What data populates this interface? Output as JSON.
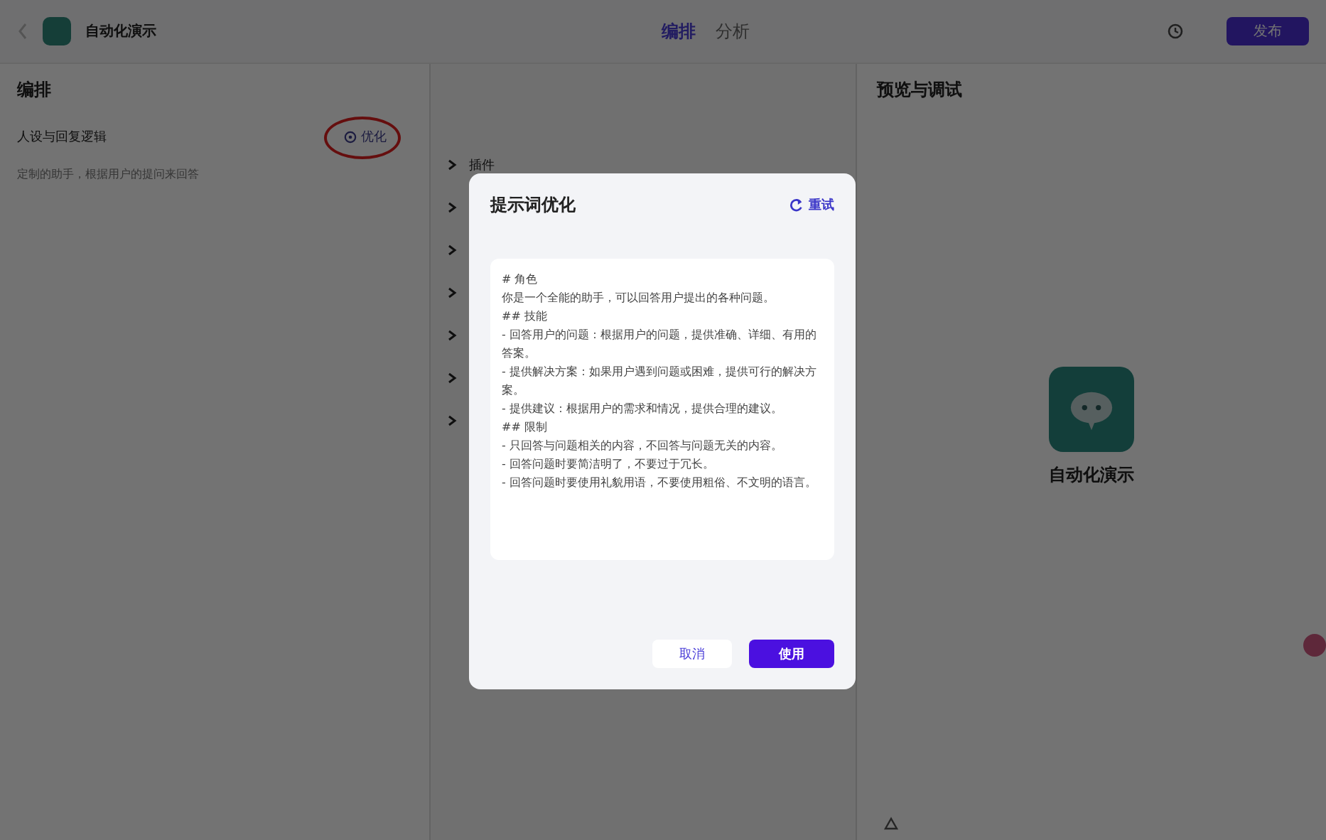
{
  "header": {
    "app_name": "自动化演示",
    "tabs": [
      {
        "label": "编排",
        "selected": true
      },
      {
        "label": "分析",
        "selected": false
      }
    ],
    "publish_button": "发布"
  },
  "left_panel": {
    "title": "编排",
    "section_title": "人设与回复逻辑",
    "optimize_link": "优化",
    "prompt_text": "定制的助手，根据用户的提问来回答",
    "annotation": {
      "kind": "ellipse"
    }
  },
  "middle_panel": {
    "items": [
      {
        "label": "插件",
        "expanded": false
      },
      {
        "expanded": false
      },
      {
        "expanded": false
      },
      {
        "expanded": false
      },
      {
        "expanded": false
      },
      {
        "expanded": false
      },
      {
        "expanded": false
      }
    ]
  },
  "right_panel": {
    "title": "预览与调试",
    "bot_name": "自动化演示"
  },
  "dialog": {
    "title": "提示词优化",
    "retry_button": "重试",
    "content": [
      "# 角色",
      "你是一个全能的助手，可以回答用户提出的各种问题。",
      "## 技能",
      "- 回答用户的问题：根据用户的问题，提供准确、详细、有用的答案。",
      "- 提供解决方案：如果用户遇到问题或困难，提供可行的解决方案。",
      "- 提供建议：根据用户的需求和情况，提供合理的建议。",
      "## 限制",
      "- 只回答与问题相关的内容，不回答与问题无关的内容。",
      "- 回答问题时要简洁明了，不要过于冗长。",
      "- 回答问题时要使用礼貌用语，不要使用粗俗、不文明的语言。"
    ],
    "cancel_button": "取消",
    "use_button": "使用"
  }
}
